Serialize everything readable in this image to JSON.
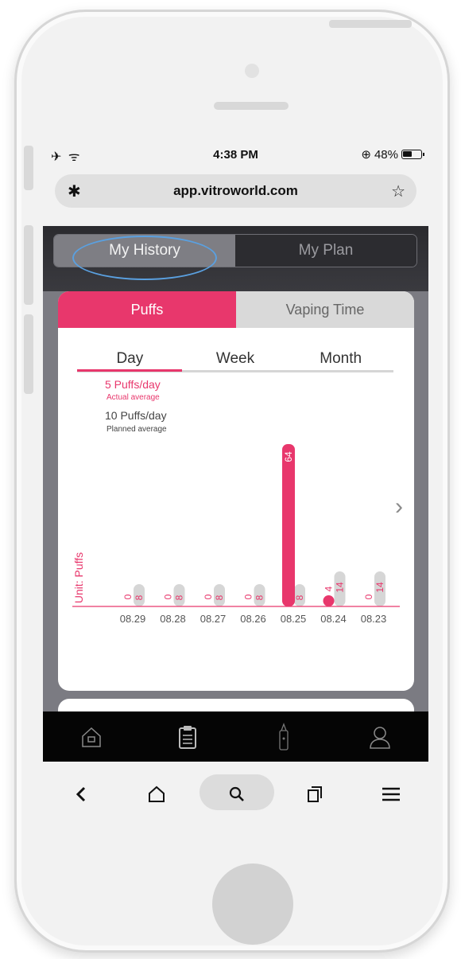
{
  "status_bar": {
    "left_icons": "✈ ᯤ",
    "time": "4:38 PM",
    "battery_text": "48%",
    "lock_icon": "⊕"
  },
  "browser": {
    "url": "app.vitroworld.com",
    "bluetooth_glyph": "✱",
    "star_glyph": "☆"
  },
  "app": {
    "segments": [
      {
        "label": "My History",
        "active": true
      },
      {
        "label": "My Plan",
        "active": false
      }
    ],
    "metric_tabs": [
      {
        "label": "Puffs",
        "active": true
      },
      {
        "label": "Vaping Time",
        "active": false
      }
    ],
    "period_tabs": [
      {
        "label": "Day",
        "active": true
      },
      {
        "label": "Week",
        "active": false
      },
      {
        "label": "Month",
        "active": false
      }
    ],
    "actual_average": "5 Puffs/day",
    "actual_average_label": "Actual average",
    "planned_average": "10 Puffs/day",
    "planned_average_label": "Planned average",
    "colors": {
      "accent": "#e8376c",
      "planned_bar": "#d6d6d6"
    }
  },
  "chart_data": {
    "type": "bar",
    "ylabel": "Unit: Puffs",
    "categories": [
      "08.29",
      "08.28",
      "08.27",
      "08.26",
      "08.25",
      "08.24",
      "08.23"
    ],
    "series": [
      {
        "values": [
          0,
          0,
          0,
          0,
          64,
          4,
          0
        ]
      },
      {
        "values": [
          8,
          8,
          8,
          8,
          8,
          14,
          14
        ]
      }
    ]
  },
  "app_nav": {
    "icons": [
      "home-icon",
      "clipboard-icon",
      "device-icon",
      "profile-icon"
    ]
  },
  "browser_toolbar": {
    "icons": [
      "back-icon",
      "browser-home-icon",
      "search-icon",
      "tabs-icon",
      "menu-icon"
    ]
  }
}
